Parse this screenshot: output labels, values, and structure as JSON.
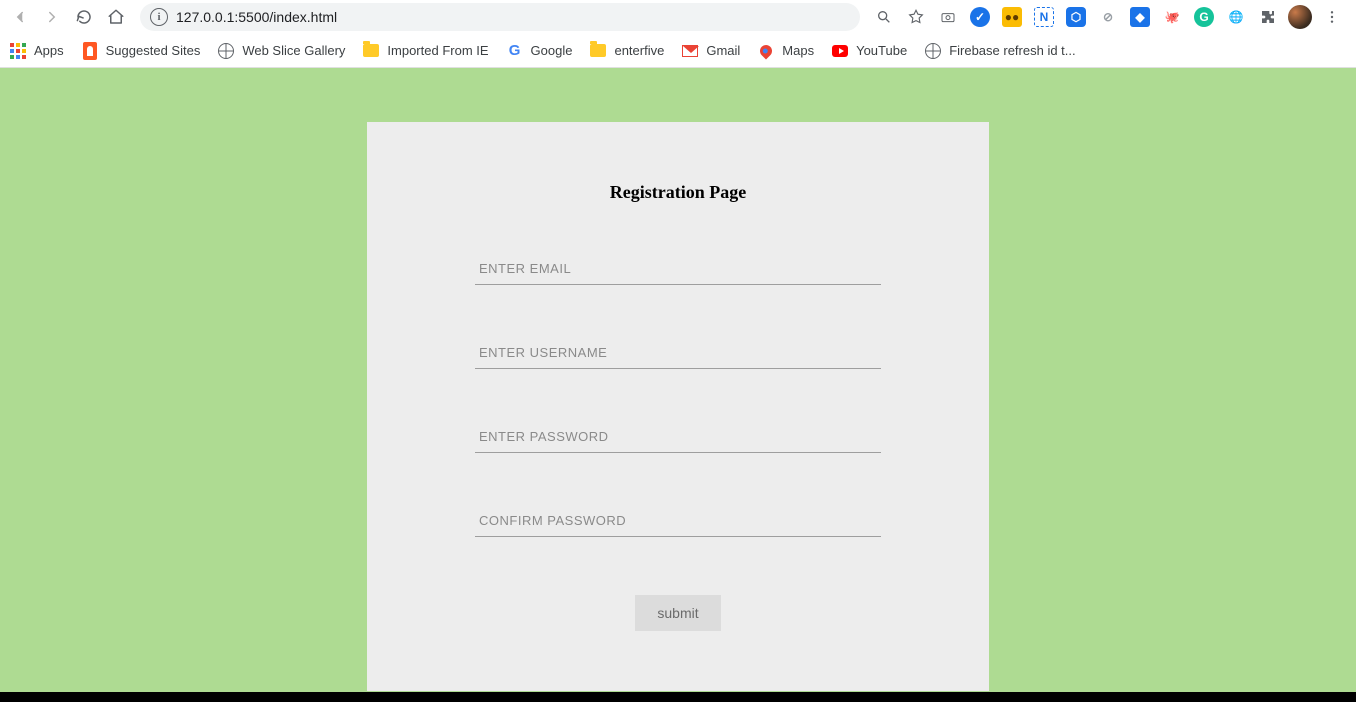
{
  "browser": {
    "url": "127.0.0.1:5500/index.html",
    "bookmarks": [
      {
        "label": "Apps",
        "icon": "apps"
      },
      {
        "label": "Suggested Sites",
        "icon": "ss"
      },
      {
        "label": "Web Slice Gallery",
        "icon": "globe"
      },
      {
        "label": "Imported From IE",
        "icon": "folder"
      },
      {
        "label": "Google",
        "icon": "g"
      },
      {
        "label": "enterfive",
        "icon": "folder"
      },
      {
        "label": "Gmail",
        "icon": "gmail"
      },
      {
        "label": "Maps",
        "icon": "maps"
      },
      {
        "label": "YouTube",
        "icon": "yt"
      },
      {
        "label": "Firebase refresh id t...",
        "icon": "globe"
      }
    ]
  },
  "page": {
    "title": "Registration Page",
    "fields": {
      "email_placeholder": "ENTER EMAIL",
      "username_placeholder": "ENTER USERNAME",
      "password_placeholder": "ENTER PASSWORD",
      "confirm_placeholder": "CONFIRM PASSWORD"
    },
    "submit_label": "submit"
  }
}
